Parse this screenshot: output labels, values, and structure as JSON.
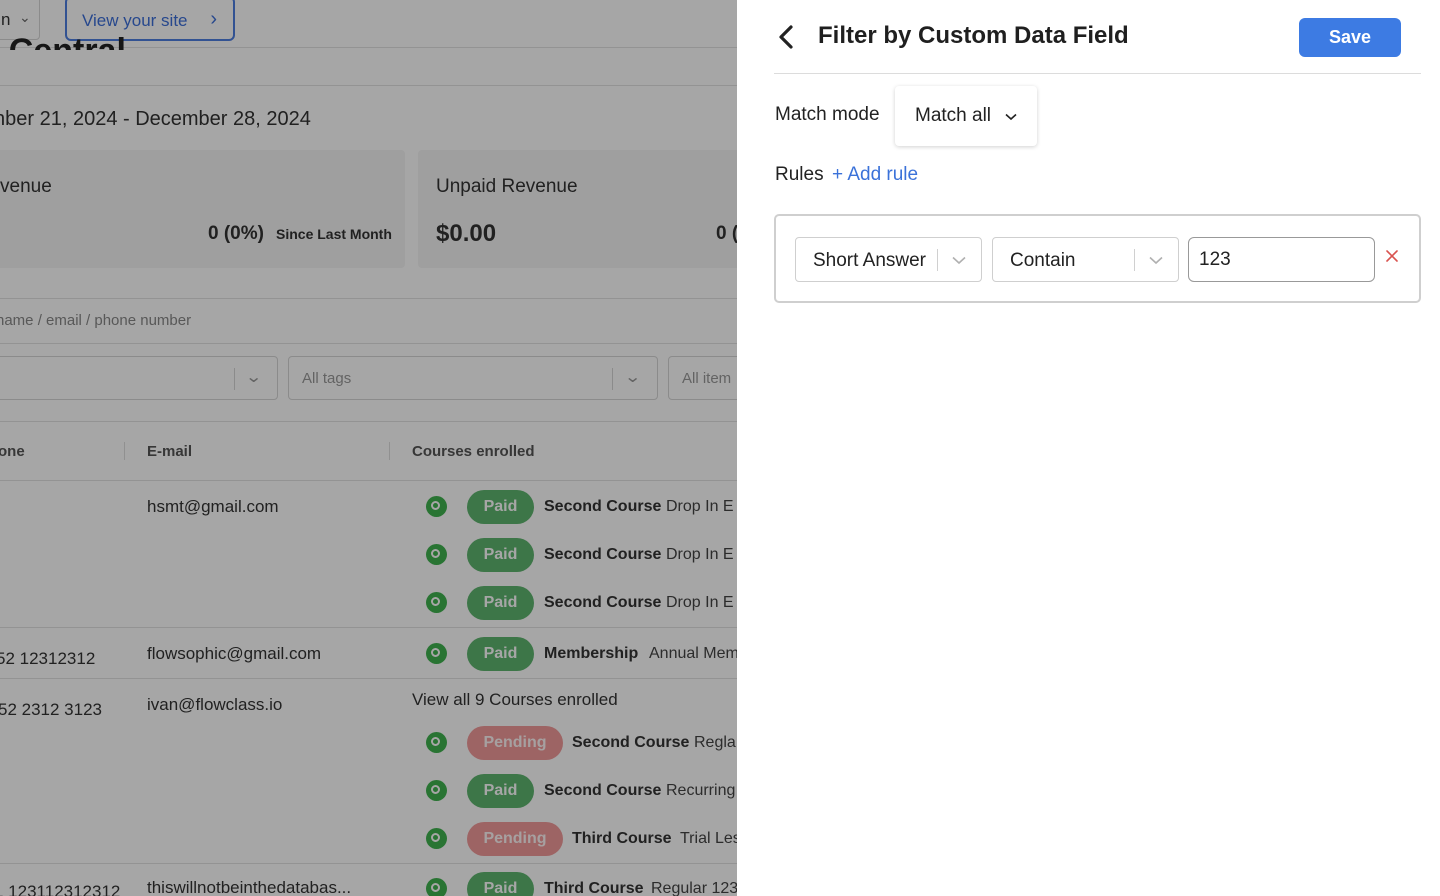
{
  "background": {
    "topbar": {
      "selector_text": "n",
      "view_site_label": "View your site"
    },
    "title_partial": "t Central",
    "date_range": "nber 21, 2024 - December 28, 2024",
    "cards": [
      {
        "label": "venue",
        "pct": "0 (0%)",
        "since": "Since Last Month"
      },
      {
        "label": "Unpaid Revenue",
        "value": "$0.00",
        "pct_partial": "0 ("
      }
    ],
    "search_placeholder": "name / email / phone number",
    "filters": {
      "tags_placeholder": "All tags",
      "items_placeholder": "All item"
    },
    "table": {
      "headers": {
        "phone": "one",
        "email": "E-mail",
        "courses": "Courses enrolled"
      },
      "rows": [
        {
          "phone": "",
          "email": "hsmt@gmail.com"
        },
        {
          "phone": "52 12312312",
          "email": "flowsophic@gmail.com"
        },
        {
          "phone": "52 2312 3123",
          "email": "ivan@flowclass.io",
          "view_all": "View all 9 Courses enrolled"
        },
        {
          "phone": "1 123112312312",
          "email": "thiswillnotbeinthedatabas..."
        }
      ],
      "enrollments": [
        {
          "status": "Paid",
          "course": "Second Course",
          "detail": "Drop In E"
        },
        {
          "status": "Paid",
          "course": "Second Course",
          "detail": "Drop In E"
        },
        {
          "status": "Paid",
          "course": "Second Course",
          "detail": "Drop In E"
        },
        {
          "status": "Paid",
          "course": "Membership",
          "detail": "Annual Mem"
        },
        {
          "status": "Pending",
          "course": "Second Course",
          "detail": "Regla"
        },
        {
          "status": "Paid",
          "course": "Second Course",
          "detail": "Recurring"
        },
        {
          "status": "Pending",
          "course": "Third Course",
          "detail": "Trial Les"
        },
        {
          "status": "Paid",
          "course": "Third Course",
          "detail": "Regular 123"
        }
      ]
    }
  },
  "panel": {
    "title": "Filter by Custom Data Field",
    "save_label": "Save",
    "match_mode_label": "Match mode",
    "match_mode_value": "Match all",
    "rules_label": "Rules",
    "add_rule_label": "+ Add rule",
    "rule": {
      "field": "Short Answer",
      "operator": "Contain",
      "value": "123"
    }
  },
  "colors": {
    "accent": "#3d7be3",
    "paid": "#5fb56f",
    "pending": "#f29a9a",
    "whatsapp": "#3fb24f",
    "close": "#d9534f"
  }
}
